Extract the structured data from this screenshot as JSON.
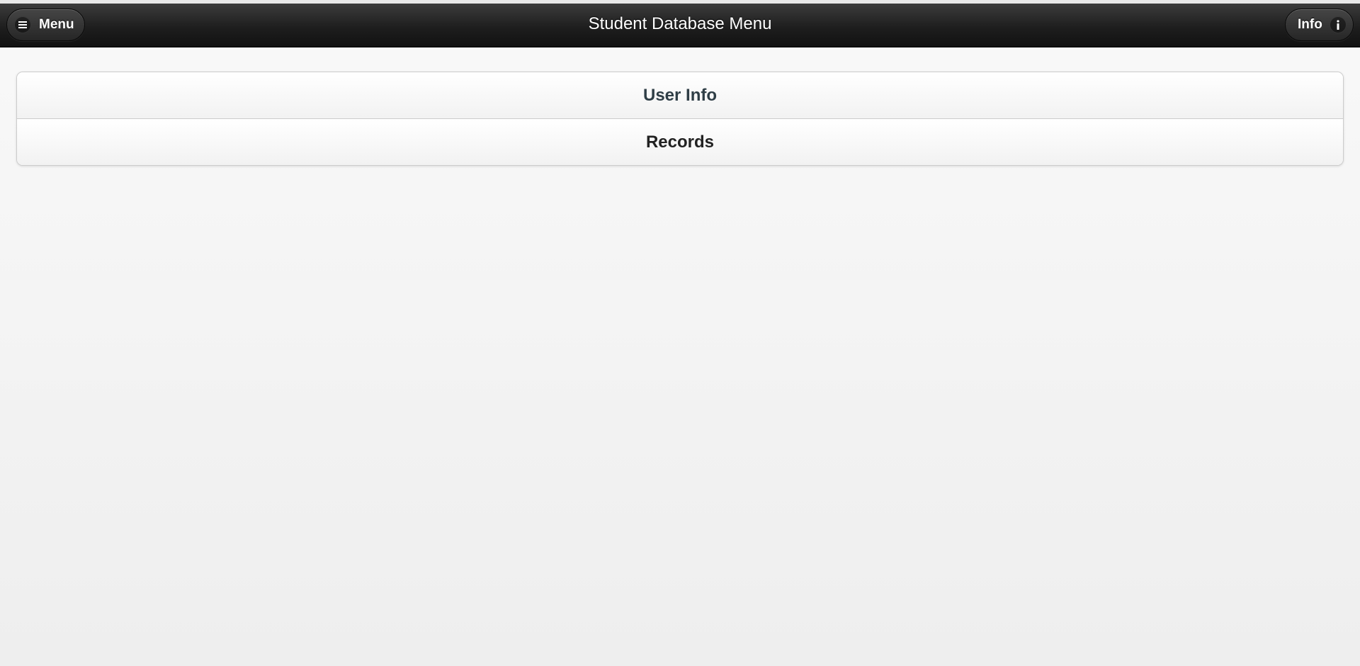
{
  "header": {
    "title": "Student Database Menu",
    "menu_button": {
      "label": "Menu",
      "icon": "bars-icon"
    },
    "info_button": {
      "label": "Info",
      "icon": "info-icon"
    }
  },
  "list": {
    "items": [
      {
        "label": "User Info"
      },
      {
        "label": "Records"
      }
    ]
  },
  "colors": {
    "header_bg": "#1e1e1e",
    "page_bg": "#f4f4f4",
    "list_bg": "#ffffff",
    "border": "#cccccc"
  }
}
